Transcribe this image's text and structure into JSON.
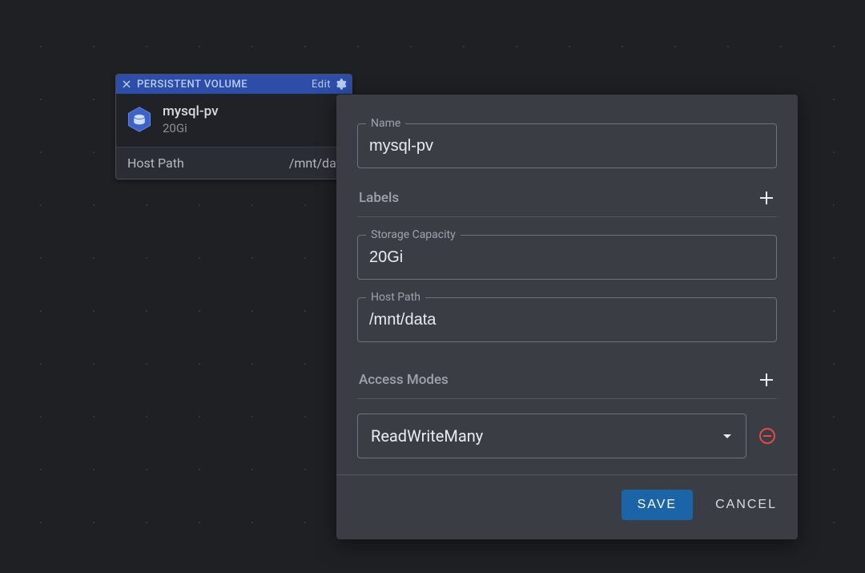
{
  "card": {
    "type_label": "PERSISTENT VOLUME",
    "edit_label": "Edit",
    "name": "mysql-pv",
    "size": "20Gi",
    "hostpath_label": "Host Path",
    "hostpath_value": "/mnt/dat"
  },
  "panel": {
    "fields": {
      "name": {
        "label": "Name",
        "value": "mysql-pv"
      },
      "storage": {
        "label": "Storage Capacity",
        "value": "20Gi"
      },
      "hostpath": {
        "label": "Host Path",
        "value": "/mnt/data"
      }
    },
    "labels_section": "Labels",
    "access_modes_section": "Access Modes",
    "access_mode_selected": "ReadWriteMany",
    "save_label": "SAVE",
    "cancel_label": "CANCEL"
  },
  "colors": {
    "accent_blue": "#1b64a7",
    "danger_red": "#e14b4b",
    "hex_blue": "#3d62c8"
  }
}
